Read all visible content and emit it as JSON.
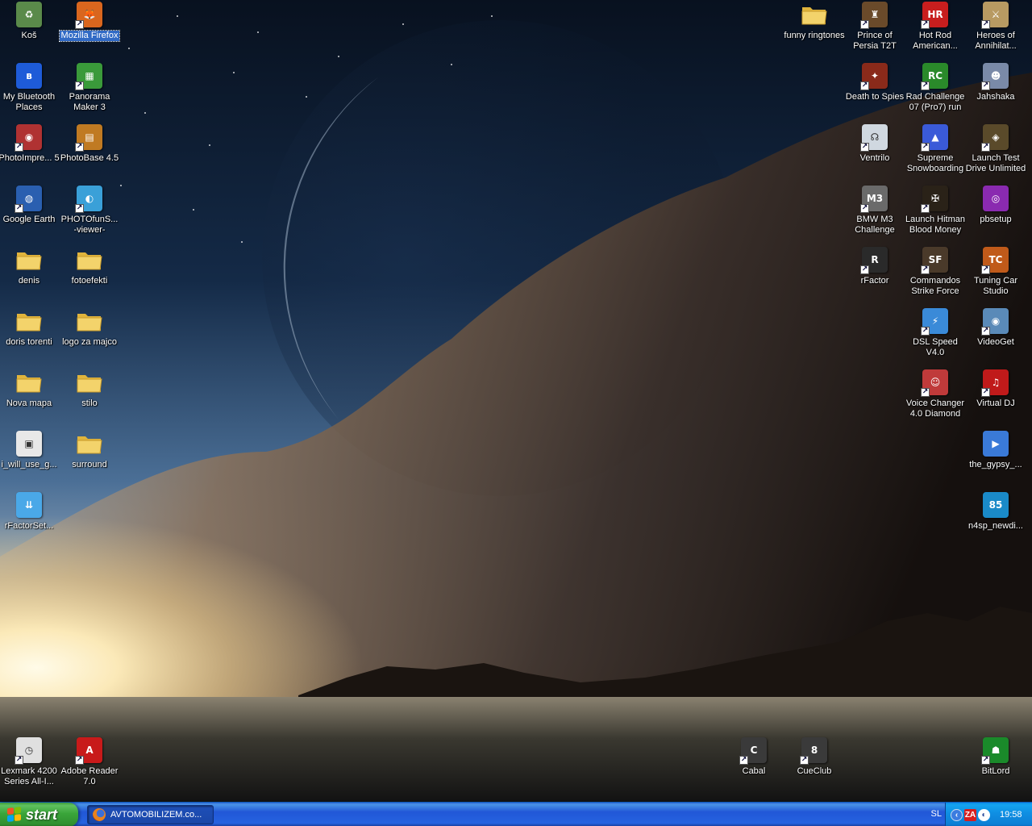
{
  "desktop": {
    "icons": [
      {
        "label": "Koš",
        "icon": "recycle-bin-icon",
        "color": "#5a8a4a",
        "glyph": "♻",
        "shortcut": false,
        "selected": false
      },
      {
        "label": "Mozilla Firefox",
        "icon": "firefox-icon",
        "color": "#d9661e",
        "glyph": "🦊",
        "shortcut": true,
        "selected": true
      },
      {
        "label": "My Bluetooth Places",
        "icon": "bluetooth-icon",
        "color": "#1e5bd8",
        "glyph": "ʙ",
        "shortcut": false,
        "selected": false
      },
      {
        "label": "Panorama Maker 3",
        "icon": "panorama-maker-icon",
        "color": "#3a9a3a",
        "glyph": "▦",
        "shortcut": true,
        "selected": false
      },
      {
        "label": "PhotoImpre... 5",
        "icon": "photoimpression-icon",
        "color": "#b03232",
        "glyph": "◉",
        "shortcut": true,
        "selected": false
      },
      {
        "label": "PhotoBase 4.5",
        "icon": "photobase-icon",
        "color": "#c07a22",
        "glyph": "▤",
        "shortcut": true,
        "selected": false
      },
      {
        "label": "Google Earth",
        "icon": "google-earth-icon",
        "color": "#2a5fb0",
        "glyph": "◍",
        "shortcut": true,
        "selected": false
      },
      {
        "label": "PHOTOfunS... -viewer-",
        "icon": "photofun-viewer-icon",
        "color": "#3aa0d8",
        "glyph": "◐",
        "shortcut": true,
        "selected": false
      },
      {
        "label": "denis",
        "icon": "folder-icon",
        "color": "#f3d36b",
        "glyph": "",
        "shortcut": false,
        "selected": false
      },
      {
        "label": "fotoefekti",
        "icon": "folder-icon",
        "color": "#f3d36b",
        "glyph": "",
        "shortcut": false,
        "selected": false
      },
      {
        "label": "doris torenti",
        "icon": "folder-icon",
        "color": "#f3d36b",
        "glyph": "",
        "shortcut": false,
        "selected": false
      },
      {
        "label": "logo za majco",
        "icon": "folder-icon",
        "color": "#f3d36b",
        "glyph": "",
        "shortcut": false,
        "selected": false
      },
      {
        "label": "Nova mapa",
        "icon": "folder-icon",
        "color": "#f3d36b",
        "glyph": "",
        "shortcut": false,
        "selected": false
      },
      {
        "label": "stilo",
        "icon": "folder-icon",
        "color": "#f3d36b",
        "glyph": "",
        "shortcut": false,
        "selected": false
      },
      {
        "label": "i_will_use_g...",
        "icon": "image-file-icon",
        "color": "#e8e8e8",
        "glyph": "▣",
        "shortcut": false,
        "selected": false
      },
      {
        "label": "surround",
        "icon": "folder-icon",
        "color": "#f3d36b",
        "glyph": "",
        "shortcut": false,
        "selected": false
      },
      {
        "label": "rFactorSet...",
        "icon": "installer-icon",
        "color": "#4aa8e8",
        "glyph": "⇊",
        "shortcut": false,
        "selected": false
      },
      {
        "label": "funny ringtones",
        "icon": "folder-icon",
        "color": "#f3d36b",
        "glyph": "",
        "shortcut": false,
        "selected": false
      },
      {
        "label": "Prince of Persia T2T",
        "icon": "prince-of-persia-icon",
        "color": "#6a4a2a",
        "glyph": "♜",
        "shortcut": true,
        "selected": false
      },
      {
        "label": "Hot Rod American...",
        "icon": "hot-rod-icon",
        "color": "#c81e1e",
        "glyph": "HR",
        "shortcut": true,
        "selected": false
      },
      {
        "label": "Heroes of Annihilat...",
        "icon": "heroes-of-annihilated-icon",
        "color": "#b89a62",
        "glyph": "⚔",
        "shortcut": true,
        "selected": false
      },
      {
        "label": "Death to Spies",
        "icon": "death-to-spies-icon",
        "color": "#8a2a1a",
        "glyph": "✦",
        "shortcut": true,
        "selected": false
      },
      {
        "label": "Rad Challenge 07 (Pro7) run",
        "icon": "rad-challenge-icon",
        "color": "#2a8a2a",
        "glyph": "RC",
        "shortcut": true,
        "selected": false
      },
      {
        "label": "Jahshaka",
        "icon": "jahshaka-icon",
        "color": "#7a8aa8",
        "glyph": "☻",
        "shortcut": true,
        "selected": false
      },
      {
        "label": "Ventrilo",
        "icon": "ventrilo-icon",
        "color": "#d0d8e0",
        "glyph": "☊",
        "shortcut": true,
        "selected": false
      },
      {
        "label": "Supreme Snowboarding",
        "icon": "supreme-snowboarding-icon",
        "color": "#3a5ad8",
        "glyph": "▲",
        "shortcut": true,
        "selected": false
      },
      {
        "label": "Launch Test Drive Unlimited",
        "icon": "test-drive-icon",
        "color": "#5a4a2a",
        "glyph": "◈",
        "shortcut": true,
        "selected": false
      },
      {
        "label": "BMW M3 Challenge",
        "icon": "bmw-m3-icon",
        "color": "#6a6a6a",
        "glyph": "M3",
        "shortcut": true,
        "selected": false
      },
      {
        "label": "Launch Hitman Blood Money",
        "icon": "hitman-icon",
        "color": "#2a2218",
        "glyph": "✠",
        "shortcut": true,
        "selected": false
      },
      {
        "label": "pbsetup",
        "icon": "pbsetup-icon",
        "color": "#8a2ab0",
        "glyph": "◎",
        "shortcut": false,
        "selected": false
      },
      {
        "label": "rFactor",
        "icon": "rfactor-icon",
        "color": "#2a2a2a",
        "glyph": "R",
        "shortcut": true,
        "selected": false
      },
      {
        "label": "Commandos Strike Force",
        "icon": "commandos-icon",
        "color": "#4a3a2a",
        "glyph": "SF",
        "shortcut": true,
        "selected": false
      },
      {
        "label": "Tuning Car Studio",
        "icon": "tuning-car-studio-icon",
        "color": "#c05a1a",
        "glyph": "TC",
        "shortcut": true,
        "selected": false
      },
      {
        "label": "DSL Speed V4.0",
        "icon": "dsl-speed-icon",
        "color": "#3a8ad8",
        "glyph": "⚡",
        "shortcut": true,
        "selected": false
      },
      {
        "label": "VideoGet",
        "icon": "videoget-icon",
        "color": "#5a8ab8",
        "glyph": "◉",
        "shortcut": true,
        "selected": false
      },
      {
        "label": "Voice Changer 4.0 Diamond",
        "icon": "voice-changer-icon",
        "color": "#c03a3a",
        "glyph": "☺",
        "shortcut": true,
        "selected": false
      },
      {
        "label": "Virtual DJ",
        "icon": "virtual-dj-icon",
        "color": "#c01a1a",
        "glyph": "♫",
        "shortcut": true,
        "selected": false
      },
      {
        "label": "the_gypsy_...",
        "icon": "media-file-icon",
        "color": "#3a7ad8",
        "glyph": "▶",
        "shortcut": false,
        "selected": false
      },
      {
        "label": "n4sp_newdi...",
        "icon": "media-disc-icon",
        "color": "#1a8ac8",
        "glyph": "85",
        "shortcut": false,
        "selected": false
      },
      {
        "label": "Lexmark 4200 Series All-I...",
        "icon": "lexmark-icon",
        "color": "#e0e0e0",
        "glyph": "◷",
        "shortcut": true,
        "selected": false
      },
      {
        "label": "Adobe Reader 7.0",
        "icon": "adobe-reader-icon",
        "color": "#c81a1a",
        "glyph": "A",
        "shortcut": true,
        "selected": false
      },
      {
        "label": "Cabal",
        "icon": "cabal-icon",
        "color": "#3a3a3a",
        "glyph": "C",
        "shortcut": true,
        "selected": false
      },
      {
        "label": "CueClub",
        "icon": "cueclub-icon",
        "color": "#3a3a3a",
        "glyph": "8",
        "shortcut": true,
        "selected": false
      },
      {
        "label": "BitLord",
        "icon": "bitlord-icon",
        "color": "#1a8a2a",
        "glyph": "☗",
        "shortcut": true,
        "selected": false
      }
    ]
  },
  "taskbar": {
    "start_label": "start",
    "tasks": [
      {
        "label": "AVTOMOBILIZEM.co...",
        "icon": "firefox-icon"
      }
    ],
    "language": "SL",
    "clock": "19:58",
    "tray_icons": [
      "chevron-left-icon",
      "zonealarm-icon",
      "messenger-icon"
    ]
  }
}
